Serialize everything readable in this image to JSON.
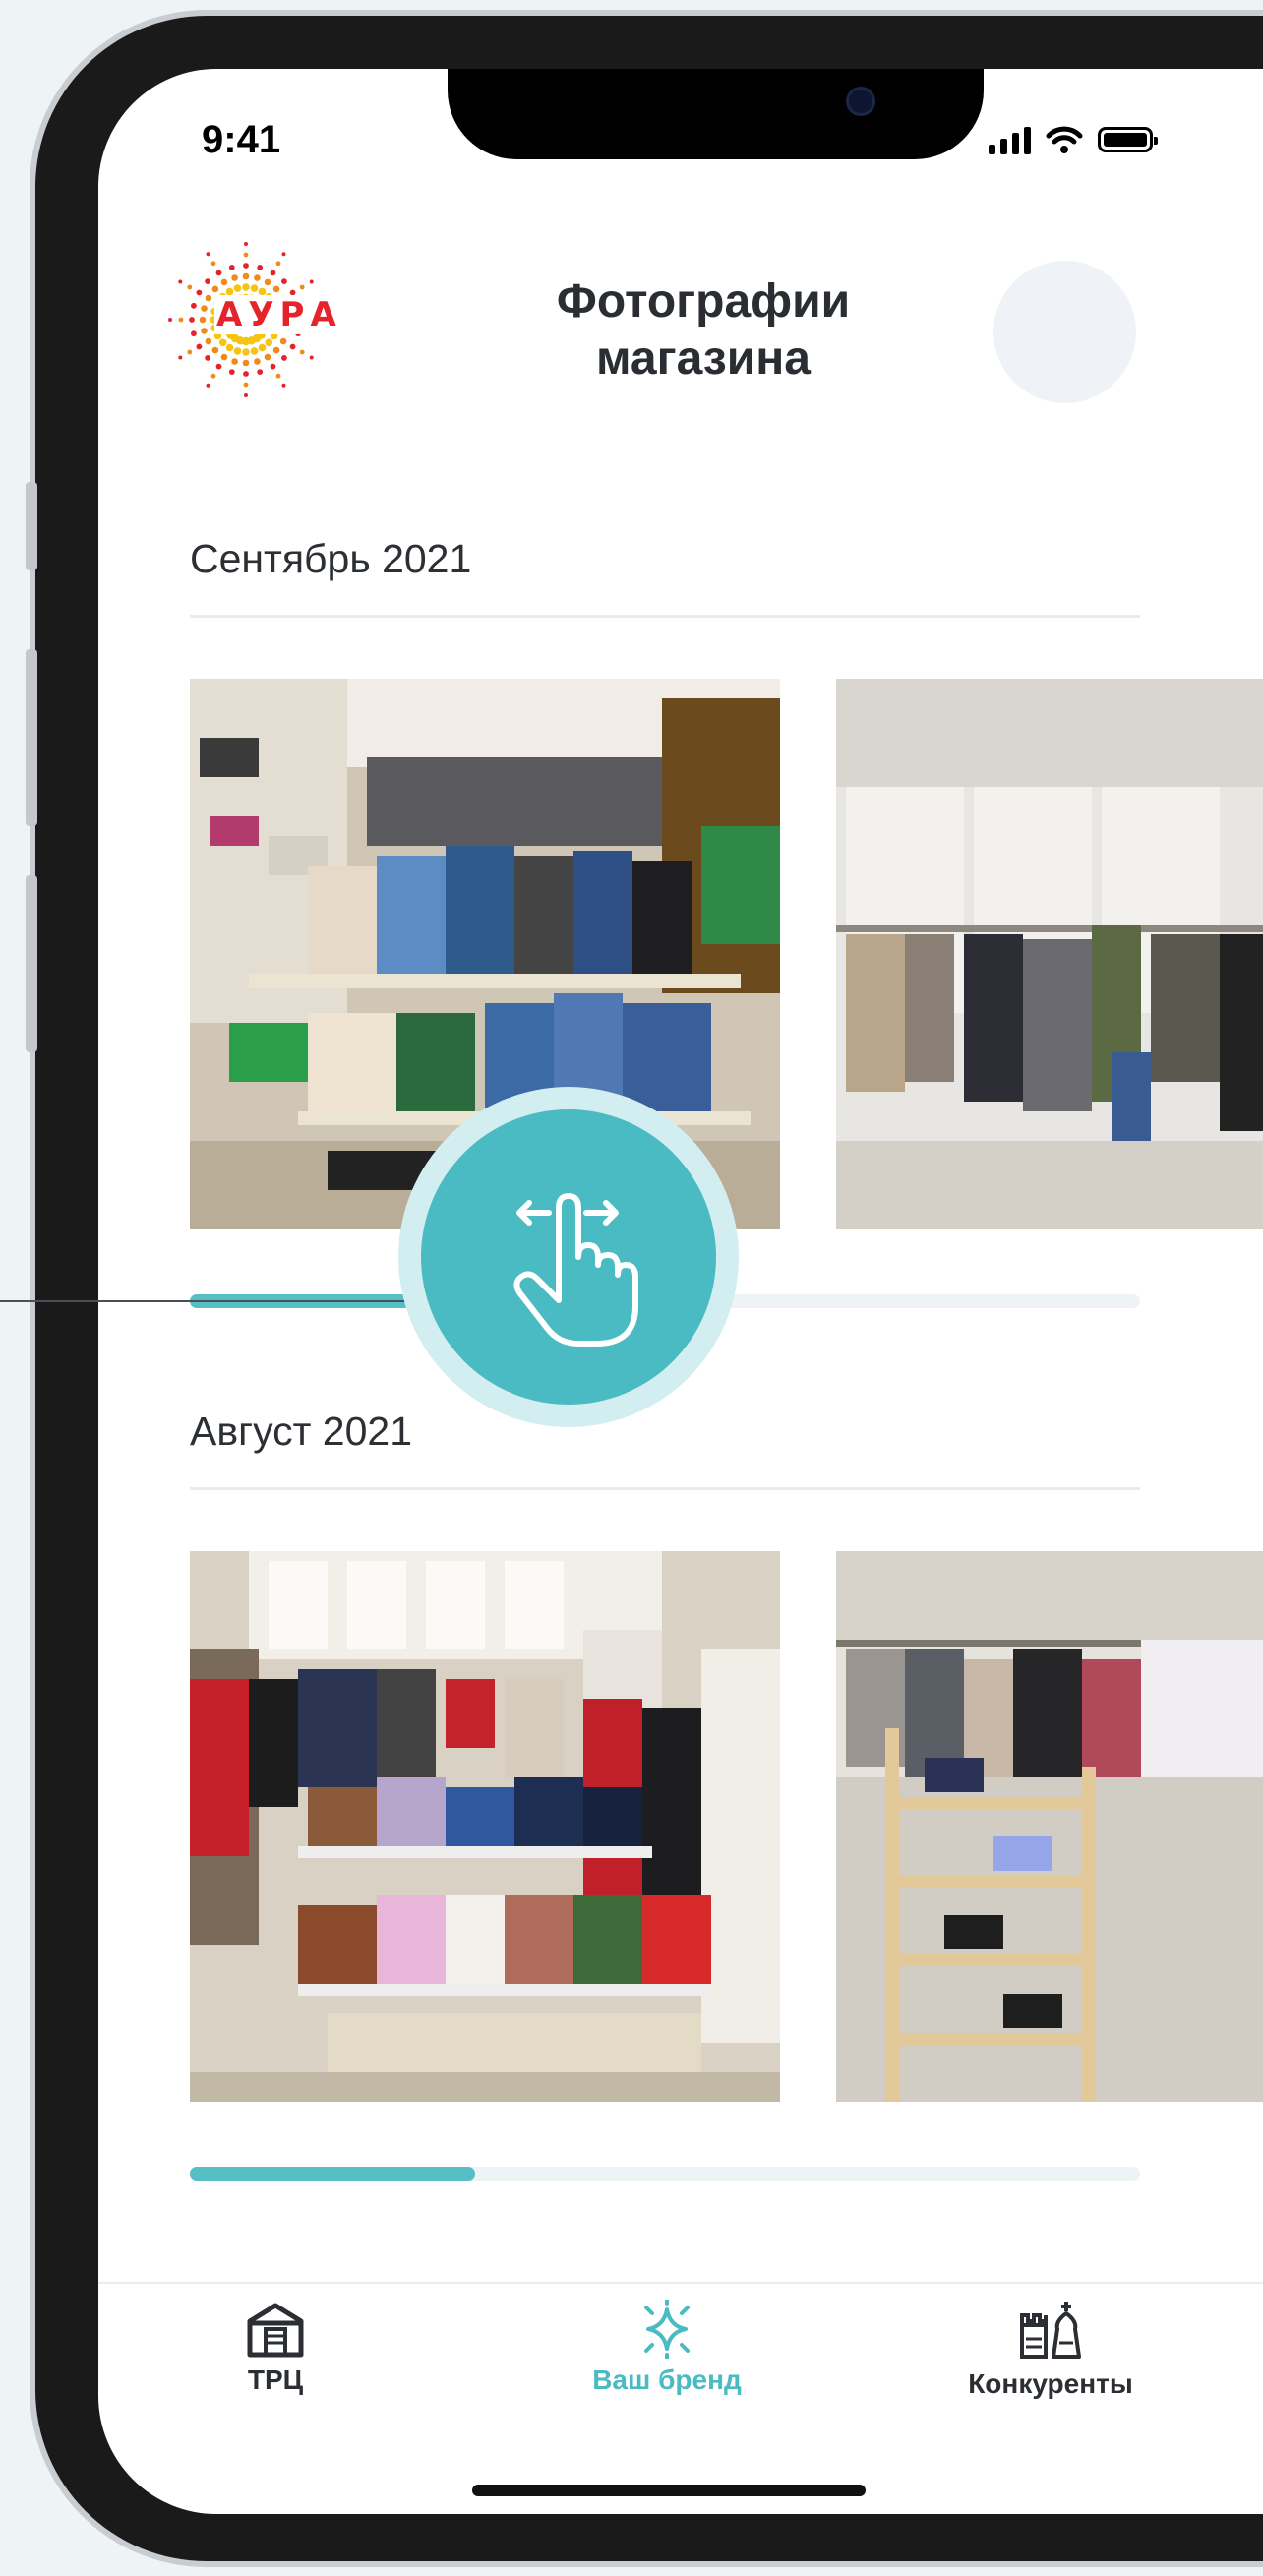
{
  "status_bar": {
    "time": "9:41"
  },
  "header": {
    "logo_text": "АУРА",
    "title": "Фотографии магазина"
  },
  "sections": [
    {
      "title": "Сентябрь 2021",
      "scroll_position_fraction": 0.3
    },
    {
      "title": "Август 2021",
      "scroll_position_fraction": 0.3
    }
  ],
  "tabbar": {
    "items": [
      {
        "label": "ТРЦ",
        "icon": "mall-icon",
        "active": false
      },
      {
        "label": "Ваш бренд",
        "icon": "sparkle-icon",
        "active": true
      },
      {
        "label": "Конкуренты",
        "icon": "chess-icon",
        "active": false
      }
    ]
  },
  "colors": {
    "accent": "#4bbbc3",
    "logo_red": "#e5232a",
    "logo_yellow": "#f6c514"
  }
}
